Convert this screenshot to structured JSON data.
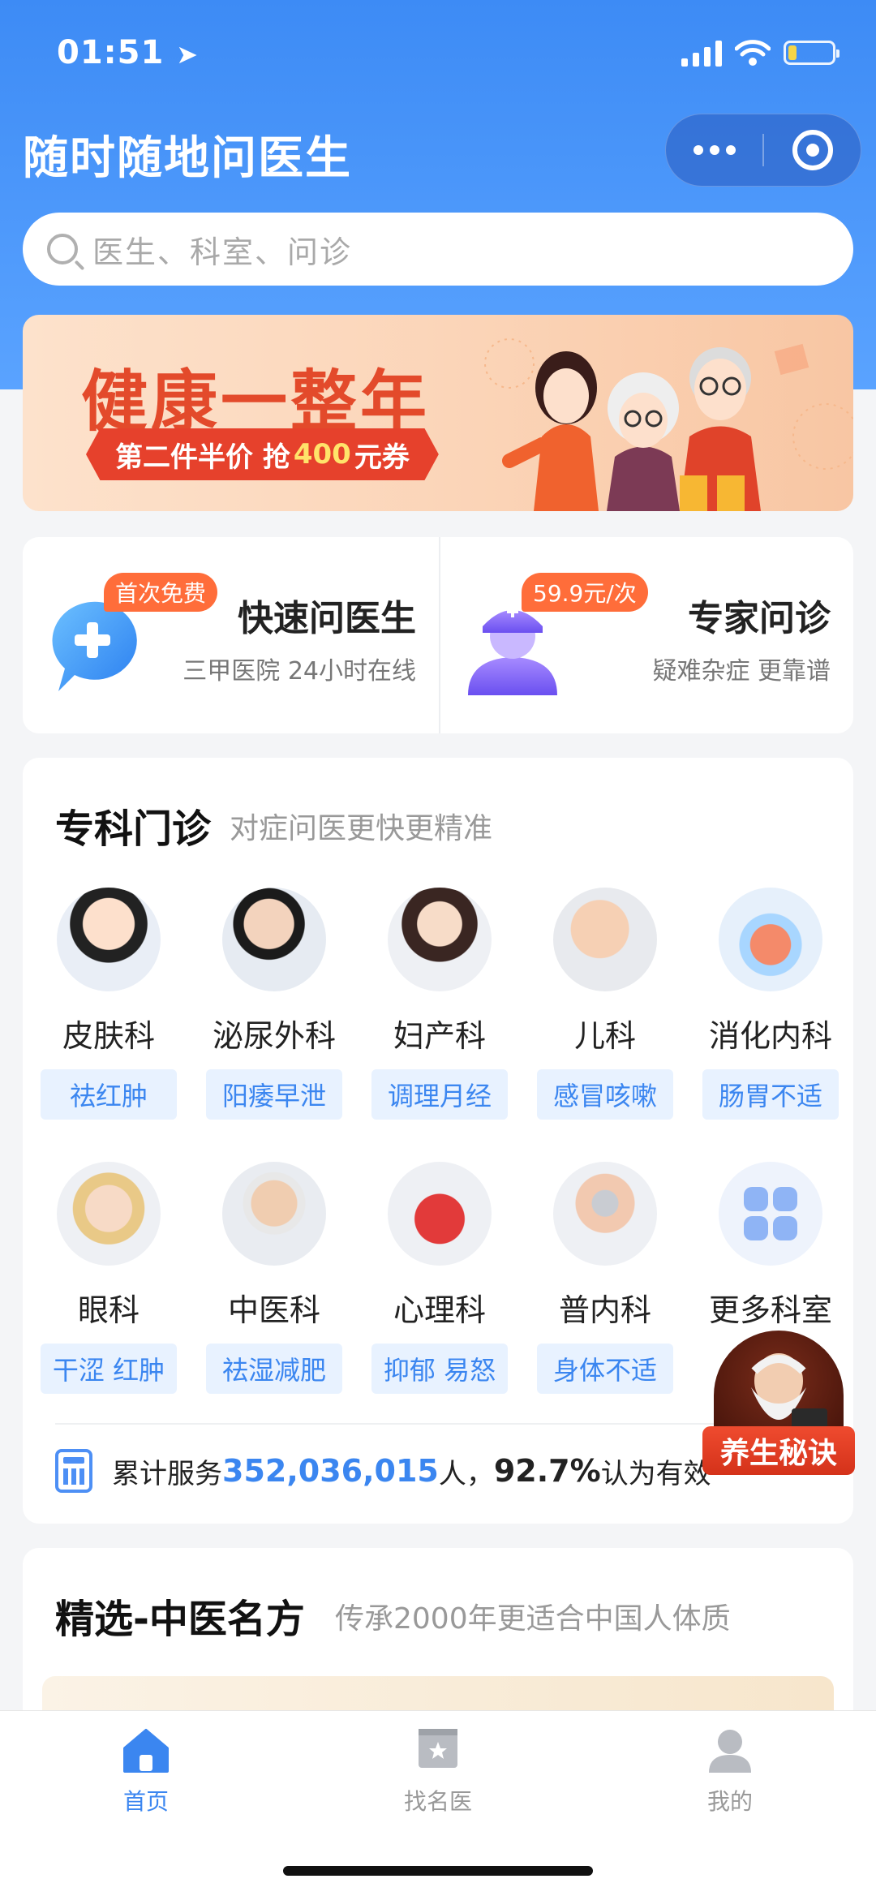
{
  "status_bar": {
    "time": "01:51"
  },
  "header": {
    "title": "随时随地问医生"
  },
  "search": {
    "placeholder": "医生、科室、问诊"
  },
  "banner": {
    "title": "健康一整年",
    "ribbon_prefix": "第二件半价 抢",
    "ribbon_highlight": "400",
    "ribbon_suffix": "元券"
  },
  "quick": [
    {
      "badge": "首次免费",
      "title": "快速问医生",
      "subtitle": "三甲医院 24小时在线"
    },
    {
      "badge": "59.9元/次",
      "title": "专家问诊",
      "subtitle": "疑难杂症 更靠谱"
    }
  ],
  "departments": {
    "title": "专科门诊",
    "subtitle": "对症问医更快更精准",
    "items": [
      {
        "name": "皮肤科",
        "tag": "祛红肿"
      },
      {
        "name": "泌尿外科",
        "tag": "阳痿早泄"
      },
      {
        "name": "妇产科",
        "tag": "调理月经"
      },
      {
        "name": "儿科",
        "tag": "感冒咳嗽"
      },
      {
        "name": "消化内科",
        "tag": "肠胃不适"
      },
      {
        "name": "眼科",
        "tag": "干涩 红肿"
      },
      {
        "name": "中医科",
        "tag": "祛湿减肥"
      },
      {
        "name": "心理科",
        "tag": "抑郁 易怒"
      },
      {
        "name": "普内科",
        "tag": "身体不适"
      },
      {
        "name": "更多科室",
        "tag": ""
      }
    ],
    "stats": {
      "prefix": "累计服务",
      "count": "352,036,015",
      "mid": "人，",
      "percent": "92.7%",
      "suffix": "认为有效"
    }
  },
  "floating": {
    "label": "养生秘诀"
  },
  "tcm": {
    "title": "精选-中医名方",
    "subtitle": "传承2000年更适合中国人体质"
  },
  "tabbar": [
    {
      "label": "首页",
      "icon": "home-icon",
      "active": true
    },
    {
      "label": "找名医",
      "icon": "doctor-badge-icon",
      "active": false
    },
    {
      "label": "我的",
      "icon": "profile-icon",
      "active": false
    }
  ],
  "colors": {
    "primary": "#3b86f0",
    "accent": "#ff6d3a",
    "banner_red": "#e34a2b"
  }
}
